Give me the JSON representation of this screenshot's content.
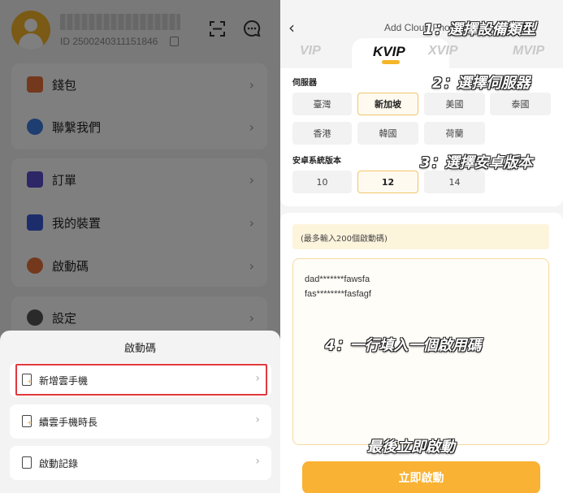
{
  "left": {
    "user_id": "ID 2500240311151846",
    "menu_group1": [
      {
        "label": "錢包",
        "icon": "wallet-icon"
      },
      {
        "label": "聯繫我們",
        "icon": "chat-bubbles-icon"
      }
    ],
    "menu_group2": [
      {
        "label": "訂單",
        "icon": "order-icon"
      },
      {
        "label": "我的裝置",
        "icon": "phone-icon"
      },
      {
        "label": "啟動碼",
        "icon": "activation-code-icon"
      }
    ],
    "menu_group3": [
      {
        "label": "設定",
        "icon": "settings-icon"
      }
    ],
    "sheet": {
      "title": "啟動碼",
      "items": [
        {
          "label": "新增雲手機",
          "icon": "add-phone-icon"
        },
        {
          "label": "續雲手機時長",
          "icon": "renew-phone-icon"
        },
        {
          "label": "啟動記錄",
          "icon": "record-icon"
        }
      ]
    }
  },
  "right": {
    "nav_title": "Add Cloud Phone",
    "tabs": [
      "VIP",
      "KVIP",
      "XVIP",
      "MVIP"
    ],
    "active_tab": "KVIP",
    "server_label": "伺服器",
    "servers": [
      "臺灣",
      "新加坡",
      "美國",
      "泰國",
      "香港",
      "韓國",
      "荷蘭"
    ],
    "selected_server": "新加坡",
    "android_label": "安卓系統版本",
    "android_versions": [
      "10",
      "12",
      "14"
    ],
    "selected_android": "12",
    "hint": "(最多輸入200個啟動碼)",
    "codes": [
      "dad*******fawsfa",
      "fas********fasfagf"
    ],
    "start_button": "立即啟動"
  },
  "annotations": {
    "step1": "1：選擇設備類型",
    "step2": "2：選擇伺服器",
    "step3": "3：選擇安卓版本",
    "step4": "4：一行填入一個啟用碼",
    "final": "最後立即啟動"
  },
  "colors": {
    "accent": "#f9b233",
    "highlight_border": "#e0393e",
    "overlay": "rgba(0,0,0,0.5)"
  }
}
